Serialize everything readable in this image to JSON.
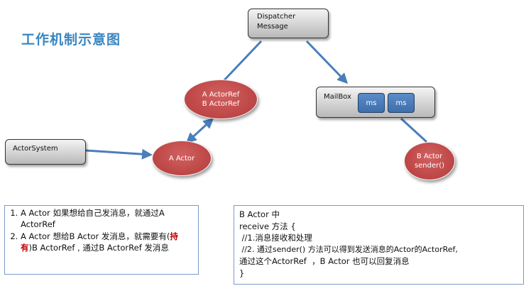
{
  "title": "工作机制示意图",
  "nodes": {
    "dispatcher": [
      "Dispatcher",
      "Message"
    ],
    "actorref": [
      "A ActorRef",
      "B ActorRef"
    ],
    "mailbox": "MailBox",
    "ms1": "ms",
    "ms2": "ms",
    "actorsystem": "ActorSystem",
    "a_actor": "A Actor",
    "b_actor": [
      "B Actor",
      "sender()"
    ]
  },
  "left_note": {
    "item1": "A Actor 如果想给自己发消息，就通过A ActorRef",
    "item2_a": "A Actor 想给B Actor 发消息，就需要有(",
    "item2_hl": "持有",
    "item2_b": ")B  ActorRef , 通过B ActorRef 发消息"
  },
  "right_note": {
    "lines": [
      "B Actor 中",
      "receive 方法 {",
      " //1.消息接收和处理",
      " //2. 通过sender() 方法可以得到发送消息的Actor的ActorRef,",
      "通过这个ActorRef  ，B Actor 也可以回复消息",
      "}"
    ]
  },
  "colors": {
    "arrow": "#4a7ebb",
    "ellipse": "#c0504d",
    "title": "#3a86c0",
    "highlight": "#c00000"
  }
}
